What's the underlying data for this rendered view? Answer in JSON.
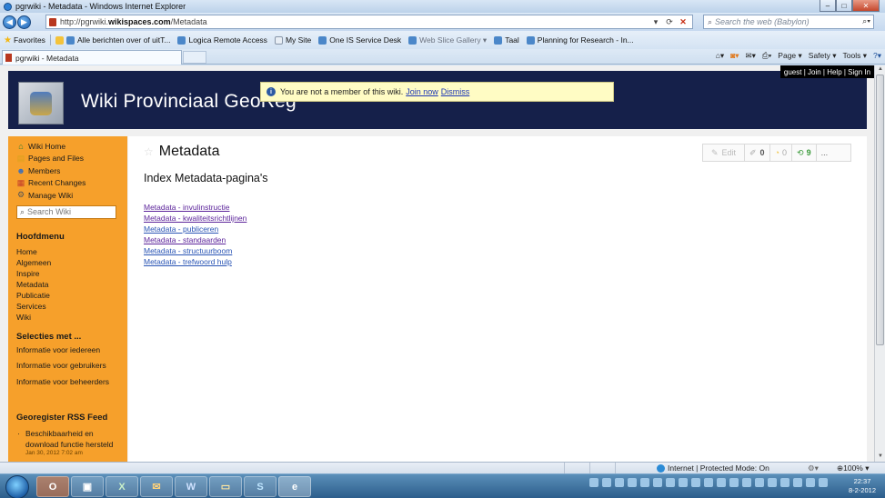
{
  "window": {
    "title": "pgrwiki - Metadata - Windows Internet Explorer"
  },
  "address": {
    "url_prefix": "http://pgrwiki.",
    "url_domain": "wikispaces.com",
    "url_path": "/Metadata",
    "search_placeholder": "Search the web (Babylon)"
  },
  "favorites": {
    "label": "Favorites",
    "items": [
      "Alle berichten over of uitT...",
      "Logica Remote Access",
      "My Site",
      "One IS Service Desk",
      "Web Slice Gallery ▾",
      "Taal",
      "Planning for Research - In..."
    ]
  },
  "tab": {
    "label": "pgrwiki - Metadata"
  },
  "commandbar": {
    "page": "Page ▾",
    "safety": "Safety ▾",
    "tools": "Tools ▾"
  },
  "wiki": {
    "title": "Wiki Provinciaal GeoReg",
    "userlinks": "guest | Join | Help | Sign In",
    "notice": {
      "text": "You are not a member of this wiki.",
      "join": "Join now",
      "dismiss": "Dismiss"
    },
    "nav": [
      "Wiki Home",
      "Pages and Files",
      "Members",
      "Recent Changes",
      "Manage Wiki"
    ],
    "search_placeholder": "Search Wiki",
    "hoofdmenu": {
      "heading": "Hoofdmenu",
      "items": [
        "Home",
        "Algemeen",
        "Inspire",
        "Metadata",
        "Publicatie",
        "Services",
        "Wiki"
      ]
    },
    "selecties": {
      "heading": "Selecties met ...",
      "items": [
        "Informatie voor iedereen",
        "Informatie voor gebruikers",
        "Informatie voor beheerders"
      ]
    },
    "rss": {
      "heading": "Georegister RSS Feed",
      "item": "Beschikbaarheid en download functie hersteld",
      "date": "Jan 30, 2012 7:02 am"
    },
    "page": {
      "title": "Metadata",
      "subtitle": "Index Metadata-pagina's",
      "toolbar": {
        "edit": "Edit",
        "count1": "0",
        "count2": "0",
        "count3": "9",
        "more": "..."
      },
      "links": [
        "Metadata - invulinstructie",
        "Metadata - kwaliteitsrichtlijnen",
        "Metadata - publiceren",
        "Metadata - standaarden",
        "Metadata - structuurboom",
        "Metadata - trefwoord hulp"
      ]
    }
  },
  "status": {
    "zone": "Internet | Protected Mode: On",
    "zoom": "100%"
  },
  "clock": {
    "time": "22:37",
    "date": "8-2-2012"
  }
}
